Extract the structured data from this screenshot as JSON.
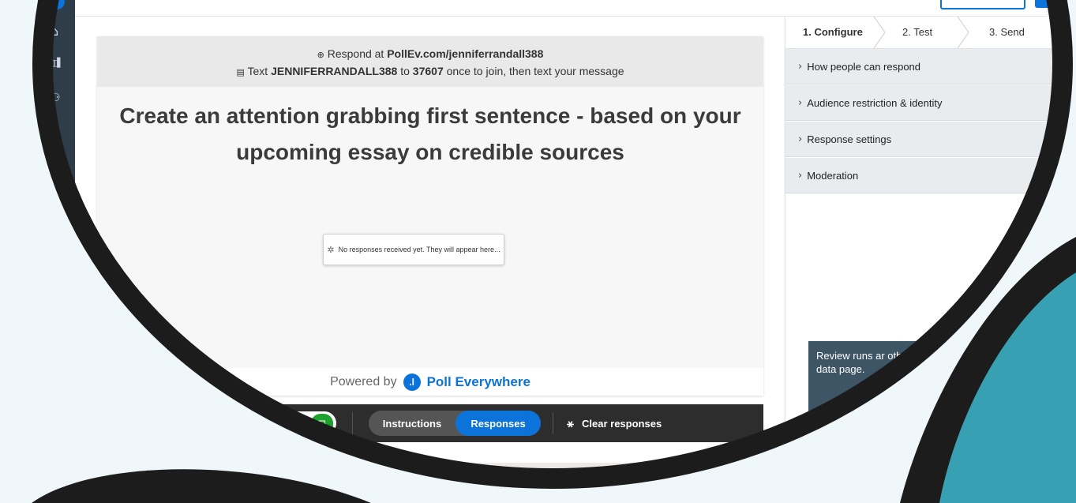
{
  "colors": {
    "page_bg": "#f0f7fb",
    "frame": "#1c1c1c",
    "teal": "#37a1b3",
    "accent": "#0b73d9",
    "lock_green": "#1ea12f"
  },
  "sidebar": {
    "logo_icon": "bar-chart-icon",
    "items": [
      {
        "icon": "home-icon",
        "glyph": "⌂"
      },
      {
        "icon": "activities-icon",
        "glyph": "▯▯▌"
      },
      {
        "icon": "participants-icon",
        "glyph": "⚇"
      }
    ]
  },
  "slide": {
    "respond_prefix": "Respond at ",
    "respond_url": "PollEv.com/jenniferrandall388",
    "text_prefix": "Text ",
    "text_code": "JENNIFERRANDALL388",
    "text_mid": " to ",
    "text_number": "37607",
    "text_suffix": " once to join, then text your message",
    "title": "Create an attention grabbing first sentence - based on your upcoming essay on credible sources",
    "empty_message": "No responses received yet. They will appear here...",
    "powered_by": "Powered by",
    "brand": "Poll Everywhere"
  },
  "toolbar": {
    "lock_off_icon": "unlock-icon",
    "lock_on_icon": "lock-icon",
    "segment_instructions": "Instructions",
    "segment_responses": "Responses",
    "clear_label": "Clear responses"
  },
  "panel": {
    "steps": [
      "1. Configure",
      "2. Test",
      "3. Send"
    ],
    "sections": [
      "How people can respond",
      "Audience restriction & identity",
      "Response settings",
      "Moderation"
    ],
    "tooltip": "Review runs ar other data page."
  },
  "taskbar": {
    "apps": [
      "file-explorer-icon",
      "itunes-icon",
      "mail-icon",
      "word-icon",
      "chrome-icon",
      "teams-icon",
      "creative-cloud-icon",
      "netflix-icon",
      "terminal-icon"
    ],
    "app_colors": [
      "#3b6fb6",
      "#e04a5f",
      "#1f6fcf",
      "#2b5fb5",
      "#dd4b39",
      "#5b5fc7",
      "#da3f6a",
      "#b5121b",
      "#1a1a1a"
    ]
  }
}
